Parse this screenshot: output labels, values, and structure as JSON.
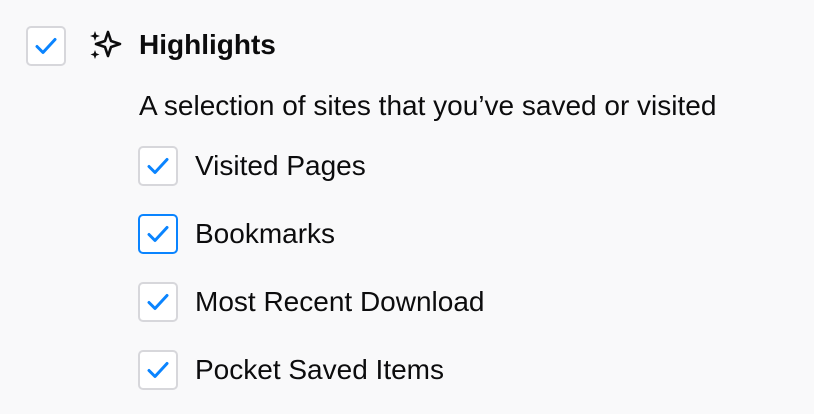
{
  "section": {
    "title": "Highlights",
    "description": "A selection of sites that you’ve saved or visited",
    "checked": true,
    "icon": "highlights-sparkle-icon"
  },
  "options": [
    {
      "label": "Visited Pages",
      "checked": true
    },
    {
      "label": "Bookmarks",
      "checked": true
    },
    {
      "label": "Most Recent Download",
      "checked": true
    },
    {
      "label": "Pocket Saved Items",
      "checked": true
    }
  ],
  "colors": {
    "checkmark": "#0a84ff",
    "focus_border": "#0a84ff",
    "checkbox_border": "#d7d7db",
    "background": "#f9f9fa"
  }
}
